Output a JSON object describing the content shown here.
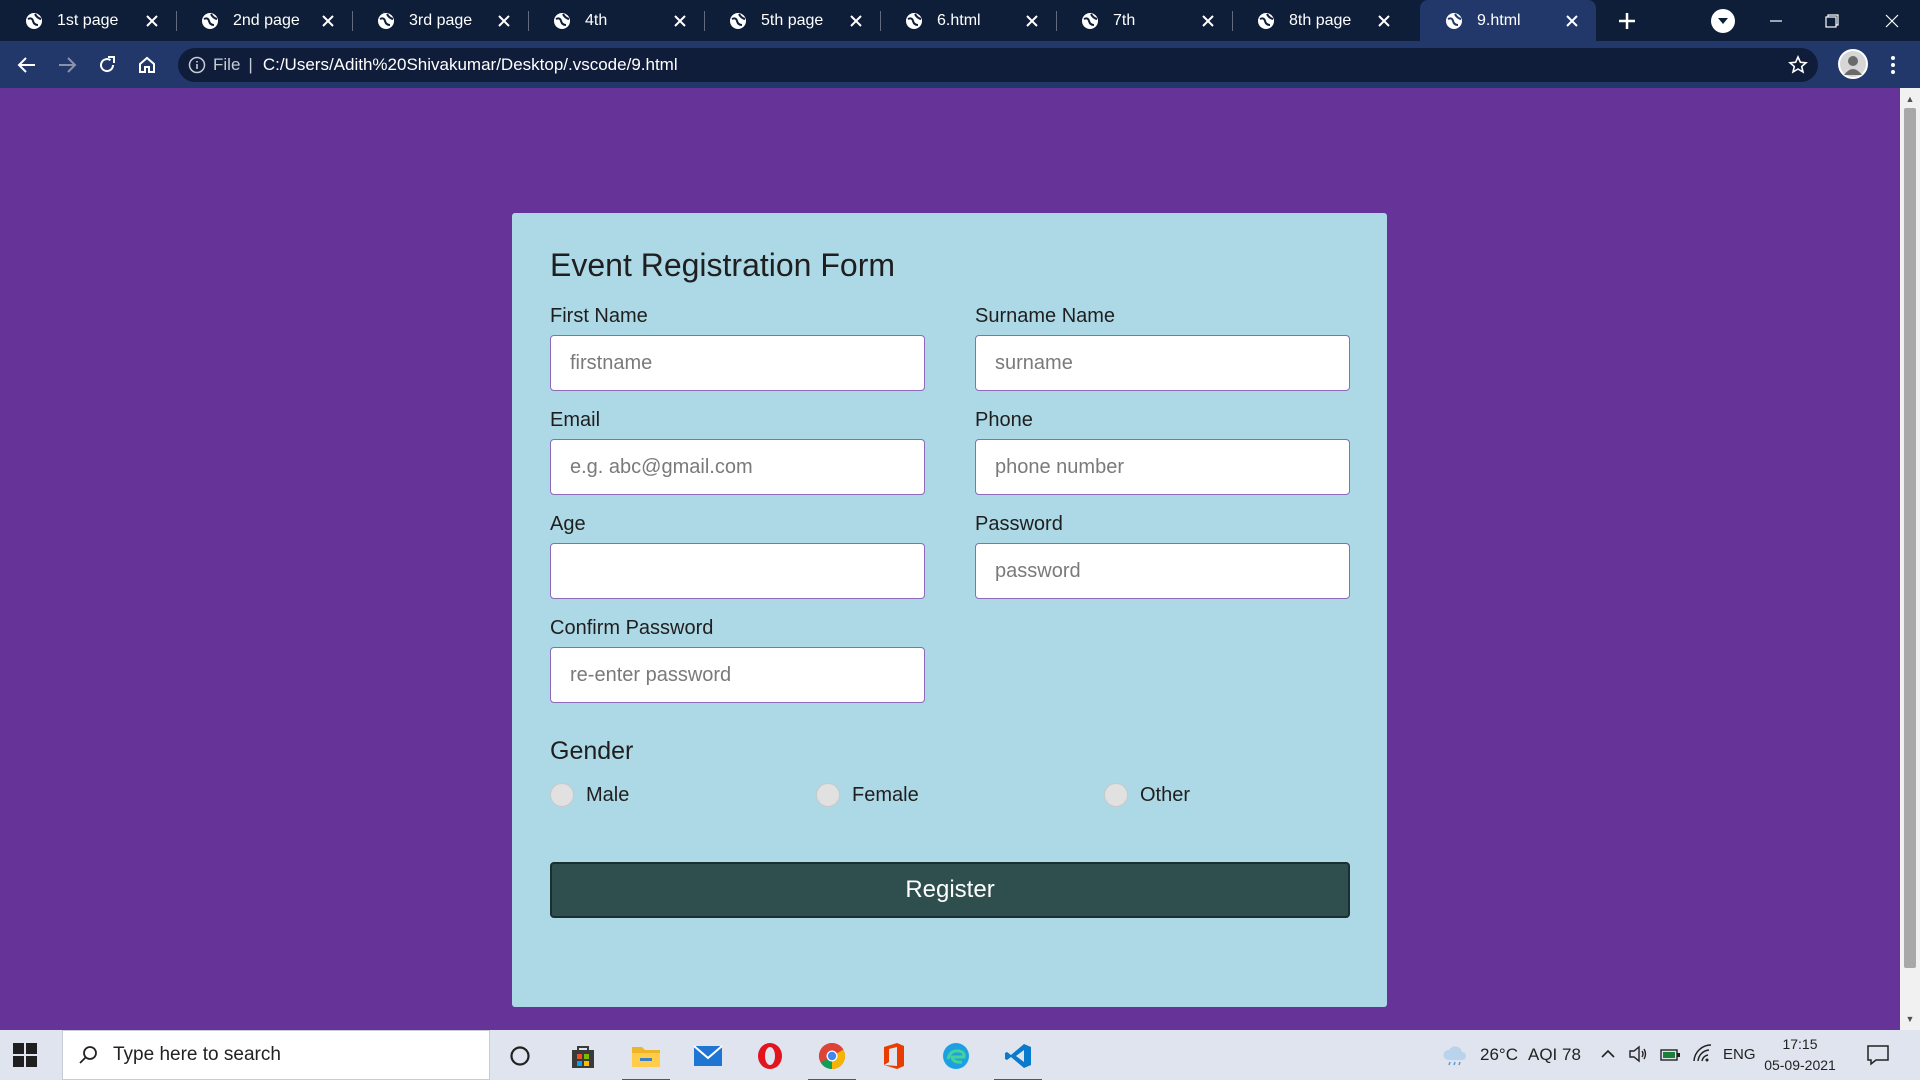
{
  "browser": {
    "tabs": [
      {
        "title": "1st page",
        "active": false
      },
      {
        "title": "2nd page",
        "active": false
      },
      {
        "title": "3rd page",
        "active": false
      },
      {
        "title": "4th",
        "active": false
      },
      {
        "title": "5th page",
        "active": false
      },
      {
        "title": "6.html",
        "active": false
      },
      {
        "title": "7th",
        "active": false
      },
      {
        "title": "8th page",
        "active": false
      },
      {
        "title": "9.html",
        "active": true
      }
    ],
    "address": {
      "scheme_label": "File",
      "separator": "|",
      "url": "C:/Users/Adith%20Shivakumar/Desktop/.vscode/9.html"
    }
  },
  "form": {
    "title": "Event Registration Form",
    "fields": [
      {
        "label": "First Name",
        "placeholder": "firstname",
        "value": ""
      },
      {
        "label": "Surname Name",
        "placeholder": "surname",
        "value": ""
      },
      {
        "label": "Email",
        "placeholder": "e.g. abc@gmail.com",
        "value": ""
      },
      {
        "label": "Phone",
        "placeholder": "phone number",
        "value": ""
      },
      {
        "label": "Age",
        "placeholder": "",
        "value": ""
      },
      {
        "label": "Password",
        "placeholder": "password",
        "value": ""
      },
      {
        "label": "Confirm Password",
        "placeholder": "re-enter password",
        "value": ""
      }
    ],
    "gender": {
      "title": "Gender",
      "options": [
        "Male",
        "Female",
        "Other"
      ]
    },
    "submit_label": "Register"
  },
  "colors": {
    "page_background": "#663399",
    "card_background": "#add8e6",
    "button_background": "#2f4f4f",
    "tab_strip": "#0e1d38",
    "toolbar": "#23386a"
  },
  "taskbar": {
    "search_placeholder": "Type here to search",
    "pinned_icons": [
      "cortana-icon",
      "store-icon",
      "file-explorer-icon",
      "mail-icon",
      "opera-icon",
      "chrome-icon",
      "office-icon",
      "edge-icon",
      "vscode-icon"
    ],
    "weather": "26°C",
    "aqi": "AQI 78",
    "language": "ENG",
    "time": "17:15",
    "date": "05-09-2021"
  }
}
